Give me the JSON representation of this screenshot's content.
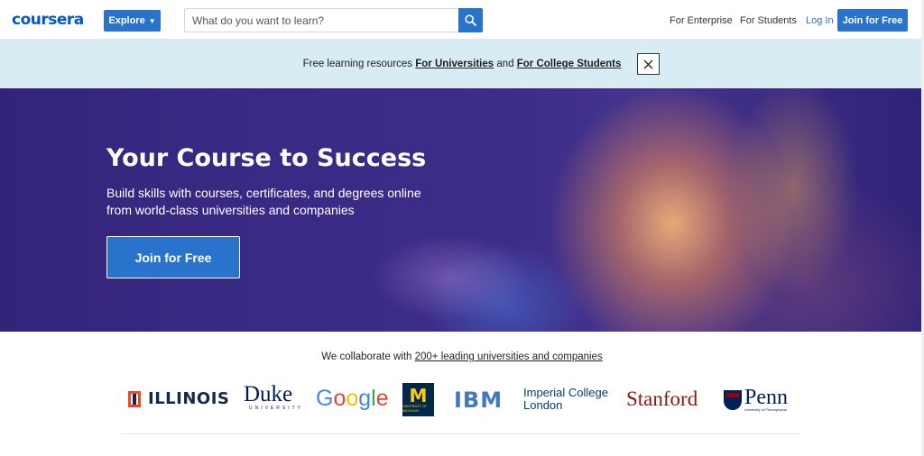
{
  "nav": {
    "logo": "coursera",
    "explore_label": "Explore",
    "search_placeholder": "What do you want to learn?",
    "links": [
      "For Enterprise",
      "For Students",
      "Log In"
    ],
    "join_label": "Join for Free"
  },
  "banner": {
    "prefix": "Free learning resources ",
    "link_universities": "For Universities",
    "and": " and ",
    "link_students": "For College Students"
  },
  "hero": {
    "title": "Your Course to Success",
    "subtitle": "Build skills with courses, certificates, and degrees online from world-class universities and companies",
    "cta": "Join for Free"
  },
  "partners": {
    "intro": "We collaborate with ",
    "link": "200+ leading universities and companies",
    "logos": {
      "illinois": "ILLINOIS",
      "duke": "Duke",
      "duke_sub": "UNIVERSITY",
      "google": "Google",
      "michigan": "M",
      "michigan_sub": "UNIVERSITY OF MICHIGAN",
      "ibm": "IBM",
      "imperial_line1": "Imperial College",
      "imperial_line2": "London",
      "stanford": "Stanford",
      "penn": "Penn",
      "penn_sub": "University of Pennsylvania"
    }
  },
  "colors": {
    "brand_blue": "#0056d2",
    "button_blue": "#2a73cc",
    "banner_bg": "#d8ecf3",
    "hero_bg": "#3a2a85"
  },
  "icons": [
    "search-icon",
    "close-icon",
    "chevron-down-icon"
  ]
}
